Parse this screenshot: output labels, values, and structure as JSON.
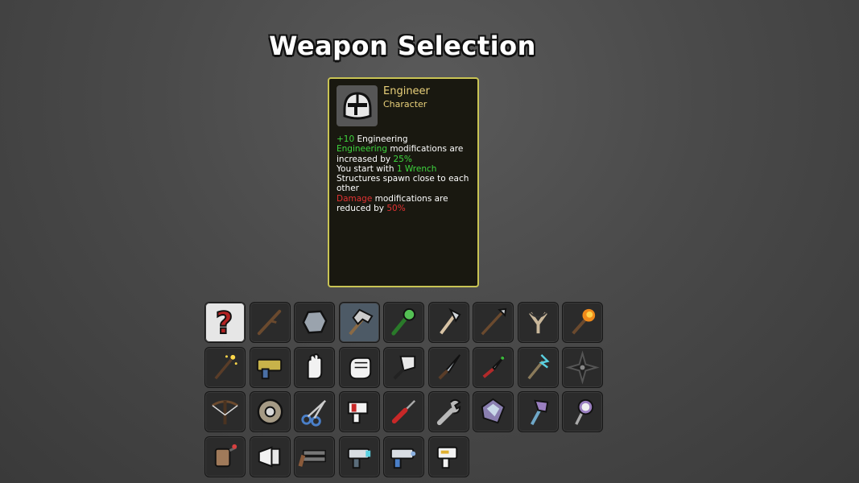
{
  "screen": {
    "title": "Weapon Selection"
  },
  "card": {
    "icon": "knight-helmet-icon",
    "name": "Engineer",
    "type": "Character",
    "desc": {
      "l1_val": "+10",
      "l1_rest": " Engineering",
      "l2_hl": "Engineering",
      "l2_rest": " modifications are increased by ",
      "l2_val": "25%",
      "l3_a": "You start with ",
      "l3_hl": "1 Wrench",
      "l4": "Structures spawn close to each other",
      "l5_hl": "Damage",
      "l5_a": " modifications are reduced by ",
      "l5_val": "50%"
    }
  },
  "weapons": [
    {
      "icon": "random-question-icon",
      "state": "random"
    },
    {
      "icon": "stick-icon"
    },
    {
      "icon": "rock-icon"
    },
    {
      "icon": "double-axe-icon",
      "state": "selected"
    },
    {
      "icon": "spiked-club-icon"
    },
    {
      "icon": "axe-icon"
    },
    {
      "icon": "spear-icon"
    },
    {
      "icon": "slingshot-icon"
    },
    {
      "icon": "torch-icon"
    },
    {
      "icon": "magic-wand-icon"
    },
    {
      "icon": "taser-icon"
    },
    {
      "icon": "hand-icon"
    },
    {
      "icon": "fist-icon"
    },
    {
      "icon": "cleaver-icon"
    },
    {
      "icon": "knife-icon"
    },
    {
      "icon": "dagger-icon"
    },
    {
      "icon": "lightning-staff-icon"
    },
    {
      "icon": "shuriken-icon"
    },
    {
      "icon": "crossbow-icon"
    },
    {
      "icon": "shield-icon"
    },
    {
      "icon": "scissors-icon"
    },
    {
      "icon": "nail-gun-icon"
    },
    {
      "icon": "screwdriver-icon"
    },
    {
      "icon": "wrench-icon"
    },
    {
      "icon": "crystal-icon"
    },
    {
      "icon": "crystal-axe-icon"
    },
    {
      "icon": "skull-staff-icon"
    },
    {
      "icon": "flamethrower-icon"
    },
    {
      "icon": "megaphone-icon"
    },
    {
      "icon": "double-barrel-icon"
    },
    {
      "icon": "blaster-icon"
    },
    {
      "icon": "plasma-gun-icon"
    },
    {
      "icon": "laser-gun-icon"
    }
  ]
}
